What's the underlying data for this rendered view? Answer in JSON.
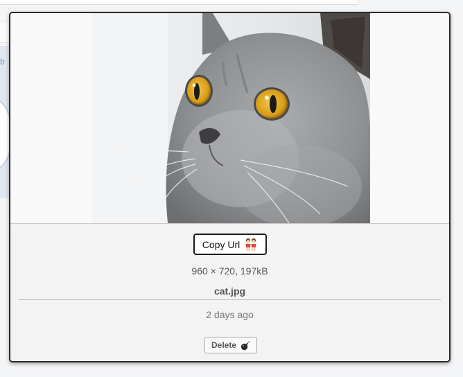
{
  "background": {
    "side_fragment": "b"
  },
  "popup": {
    "image": {
      "description_icon": "cat-photo",
      "alt": "cat.jpg"
    },
    "copy_button": {
      "label": "Copy Url",
      "icon": "two-people-icon"
    },
    "file_meta": "960 × 720, 197kB",
    "file_name": "cat.jpg",
    "timestamp": "2 days ago",
    "delete_button": {
      "label": "Delete",
      "icon": "bomb-icon"
    }
  },
  "colors": {
    "popup_border": "#2a2a2a",
    "popup_bg": "#f3f3f3",
    "cat_eye": "#d9a21b"
  }
}
